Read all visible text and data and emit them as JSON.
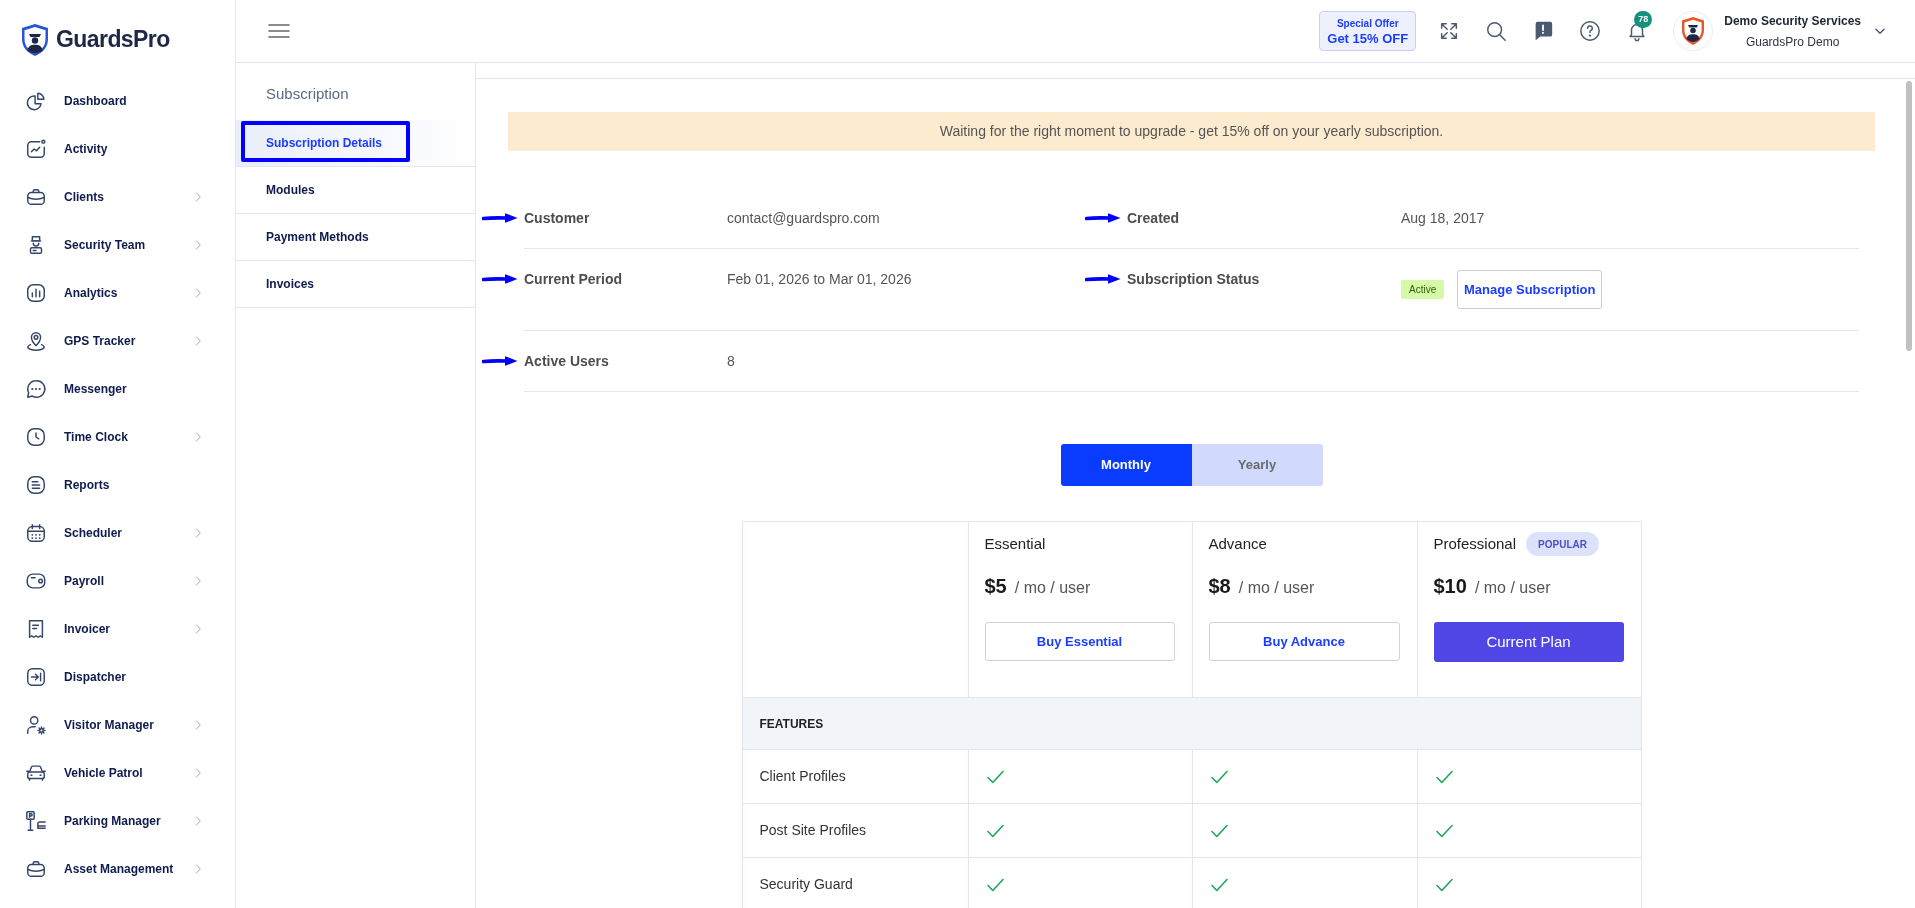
{
  "sidebar": {
    "logo": "GuardsPro",
    "items": [
      {
        "label": "Dashboard",
        "expandable": false
      },
      {
        "label": "Activity",
        "expandable": false
      },
      {
        "label": "Clients",
        "expandable": true
      },
      {
        "label": "Security Team",
        "expandable": true
      },
      {
        "label": "Analytics",
        "expandable": true
      },
      {
        "label": "GPS Tracker",
        "expandable": true
      },
      {
        "label": "Messenger",
        "expandable": false
      },
      {
        "label": "Time Clock",
        "expandable": true
      },
      {
        "label": "Reports",
        "expandable": false
      },
      {
        "label": "Scheduler",
        "expandable": true
      },
      {
        "label": "Payroll",
        "expandable": true
      },
      {
        "label": "Invoicer",
        "expandable": true
      },
      {
        "label": "Dispatcher",
        "expandable": false
      },
      {
        "label": "Visitor Manager",
        "expandable": true
      },
      {
        "label": "Vehicle Patrol",
        "expandable": true
      },
      {
        "label": "Parking Manager",
        "expandable": true
      },
      {
        "label": "Asset Management",
        "expandable": true
      }
    ]
  },
  "top_bar": {
    "offer": {
      "title": "Special Offer",
      "text": "Get 15% OFF"
    },
    "notification_count": "78",
    "user": {
      "name": "Demo Security Services",
      "company": "GuardsPro Demo"
    }
  },
  "subscription_nav": {
    "title": "Subscription",
    "items": [
      {
        "label": "Subscription Details",
        "selected": true,
        "annotated": true
      },
      {
        "label": "Modules",
        "selected": false,
        "annotated": false
      },
      {
        "label": "Payment Methods",
        "selected": false,
        "annotated": false
      },
      {
        "label": "Invoices",
        "selected": false,
        "annotated": false
      }
    ]
  },
  "banner": "Waiting for the right moment to upgrade - get 15% off on your yearly subscription.",
  "details": [
    {
      "fields": [
        {
          "kind": "text",
          "label": "Customer",
          "value": "contact@guardspro.com",
          "annotated": true
        },
        {
          "kind": "text",
          "label": "Created",
          "value": "Aug 18, 2017",
          "annotated": true
        }
      ]
    },
    {
      "fields": [
        {
          "kind": "text",
          "label": "Current Period",
          "value": "Feb 01, 2026 to Mar 01, 2026",
          "annotated": true
        },
        {
          "kind": "status",
          "label": "Subscription Status",
          "status": "Active",
          "action": "Manage Subscription",
          "annotated": true
        }
      ]
    },
    {
      "fields": [
        {
          "kind": "text",
          "label": "Active Users",
          "value": "8",
          "annotated": true
        }
      ]
    }
  ],
  "billing_toggle": [
    {
      "label": "Monthly",
      "selected": true
    },
    {
      "label": "Yearly",
      "selected": false
    }
  ],
  "pricing": {
    "plans": [
      {
        "name": "Essential",
        "price": "$5",
        "unit": "/ mo / user",
        "button": "Buy Essential",
        "current": false
      },
      {
        "name": "Advance",
        "price": "$8",
        "unit": "/ mo / user",
        "button": "Buy Advance",
        "current": false
      },
      {
        "name": "Professional",
        "badge": "POPULAR",
        "price": "$10",
        "unit": "/ mo / user",
        "button": "Current Plan",
        "current": true
      }
    ],
    "features_heading": "FEATURES",
    "features": [
      {
        "name": "Client Profiles",
        "included": [
          true,
          true,
          true
        ]
      },
      {
        "name": "Post Site Profiles",
        "included": [
          true,
          true,
          true
        ]
      },
      {
        "name": "Security Guard",
        "included": [
          true,
          true,
          true
        ]
      }
    ]
  }
}
